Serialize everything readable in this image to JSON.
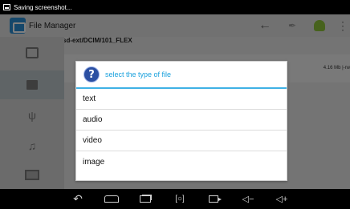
{
  "status_bar": {
    "notification_text": "Saving screenshot...",
    "icon": "screenshot-notification-icon"
  },
  "action_bar": {
    "title": "File Manager",
    "app_icon": "file-manager-icon",
    "icons": [
      "back-arrow-icon",
      "tools-icon",
      "android-icon",
      "overflow-menu-icon"
    ]
  },
  "path": "sd-ext/DCIM/101_FLEX",
  "side_nav": {
    "items": [
      {
        "icon": "phone-storage-icon"
      },
      {
        "icon": "sd-card-icon",
        "selected": true
      },
      {
        "icon": "usb-icon"
      },
      {
        "icon": "music-icon"
      },
      {
        "icon": "image-icon"
      }
    ]
  },
  "file_list": {
    "rows": [
      {
        "size_text": "4.16 Mb |-rw"
      }
    ]
  },
  "dialog": {
    "title": "select the type of file",
    "icon": "help-icon",
    "icon_glyph": "?",
    "options": [
      "text",
      "audio",
      "video",
      "image"
    ],
    "accent_color": "#3fb1e5"
  },
  "nav_bar": {
    "buttons": [
      "back-icon",
      "home-icon",
      "recent-apps-icon",
      "screenshot-icon",
      "camera-icon",
      "volume-down-icon",
      "volume-up-icon"
    ]
  }
}
